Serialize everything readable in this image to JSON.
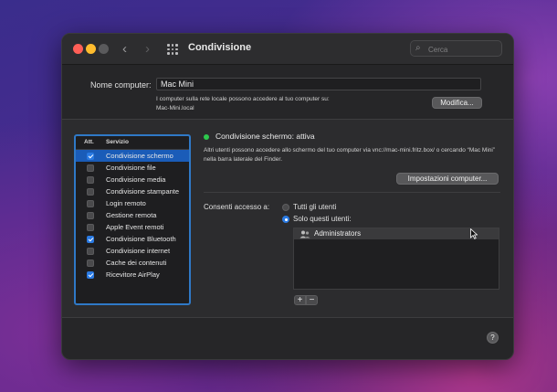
{
  "window": {
    "title": "Condivisione",
    "search_placeholder": "Cerca"
  },
  "computer_name": {
    "label": "Nome computer:",
    "value": "Mac Mini",
    "help_line1": "I computer sulla rete locale possono accedere al tuo computer su:",
    "help_line2": "Mac-Mini.local",
    "edit_button": "Modifica..."
  },
  "services": {
    "header_on": "Att.",
    "header_service": "Servizio",
    "items": [
      {
        "label": "Condivisione schermo",
        "checked": true,
        "selected": true
      },
      {
        "label": "Condivisione file",
        "checked": false,
        "selected": false
      },
      {
        "label": "Condivisione media",
        "checked": false,
        "selected": false
      },
      {
        "label": "Condivisione stampante",
        "checked": false,
        "selected": false
      },
      {
        "label": "Login remoto",
        "checked": false,
        "selected": false
      },
      {
        "label": "Gestione remota",
        "checked": false,
        "selected": false
      },
      {
        "label": "Apple Event remoti",
        "checked": false,
        "selected": false
      },
      {
        "label": "Condivisione Bluetooth",
        "checked": true,
        "selected": false
      },
      {
        "label": "Condivisione internet",
        "checked": false,
        "selected": false
      },
      {
        "label": "Cache dei contenuti",
        "checked": false,
        "selected": false
      },
      {
        "label": "Ricevitore AirPlay",
        "checked": true,
        "selected": false
      }
    ]
  },
  "detail": {
    "status": "Condivisione schermo: attiva",
    "description": "Altri utenti possono accedere allo schermo del tuo computer via vnc://mac-mini.fritz.box/ o cercando “Mac Mini” nella barra laterale del Finder.",
    "settings_button": "Impostazioni computer...",
    "access_label": "Consenti accesso a:",
    "radio_all": "Tutti gli utenti",
    "radio_only": "Solo questi utenti:",
    "selected_radio": "only",
    "users": [
      "Administrators"
    ],
    "add_label": "+",
    "remove_label": "−"
  },
  "help_label": "?",
  "colors": {
    "accent": "#2a7ae2",
    "selection": "#1a5cb8",
    "status_on": "#2dc84d"
  }
}
